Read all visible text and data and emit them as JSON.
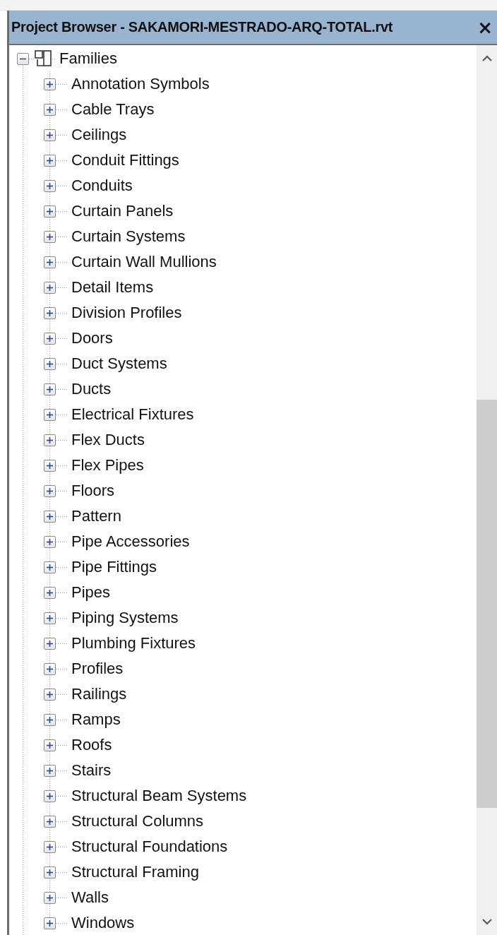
{
  "panel": {
    "title": "Project Browser - SAKAMORI-MESTRADO-ARQ-TOTAL.rvt",
    "close": "×"
  },
  "tree": [
    {
      "label": "Families",
      "expanded": true,
      "children": [
        {
          "label": "Annotation Symbols",
          "expanded": false
        },
        {
          "label": "Cable Trays",
          "expanded": false
        },
        {
          "label": "Ceilings",
          "expanded": false
        },
        {
          "label": "Conduit Fittings",
          "expanded": false
        },
        {
          "label": "Conduits",
          "expanded": false
        },
        {
          "label": "Curtain Panels",
          "expanded": false
        },
        {
          "label": "Curtain Systems",
          "expanded": false
        },
        {
          "label": "Curtain Wall Mullions",
          "expanded": false
        },
        {
          "label": "Detail Items",
          "expanded": false
        },
        {
          "label": "Division Profiles",
          "expanded": false
        },
        {
          "label": "Doors",
          "expanded": false
        },
        {
          "label": "Duct Systems",
          "expanded": false
        },
        {
          "label": "Ducts",
          "expanded": false
        },
        {
          "label": "Electrical Fixtures",
          "expanded": false
        },
        {
          "label": "Flex Ducts",
          "expanded": false
        },
        {
          "label": "Flex Pipes",
          "expanded": false
        },
        {
          "label": "Floors",
          "expanded": false
        },
        {
          "label": "Pattern",
          "expanded": false
        },
        {
          "label": "Pipe Accessories",
          "expanded": false
        },
        {
          "label": "Pipe Fittings",
          "expanded": false
        },
        {
          "label": "Pipes",
          "expanded": false
        },
        {
          "label": "Piping Systems",
          "expanded": false
        },
        {
          "label": "Plumbing Fixtures",
          "expanded": false
        },
        {
          "label": "Profiles",
          "expanded": false
        },
        {
          "label": "Railings",
          "expanded": false
        },
        {
          "label": "Ramps",
          "expanded": false
        },
        {
          "label": "Roofs",
          "expanded": false
        },
        {
          "label": "Stairs",
          "expanded": false
        },
        {
          "label": "Structural Beam Systems",
          "expanded": false
        },
        {
          "label": "Structural Columns",
          "expanded": false
        },
        {
          "label": "Structural Foundations",
          "expanded": false
        },
        {
          "label": "Structural Framing",
          "expanded": false
        },
        {
          "label": "Walls",
          "expanded": false
        },
        {
          "label": "Windows",
          "expanded": false
        }
      ]
    }
  ]
}
